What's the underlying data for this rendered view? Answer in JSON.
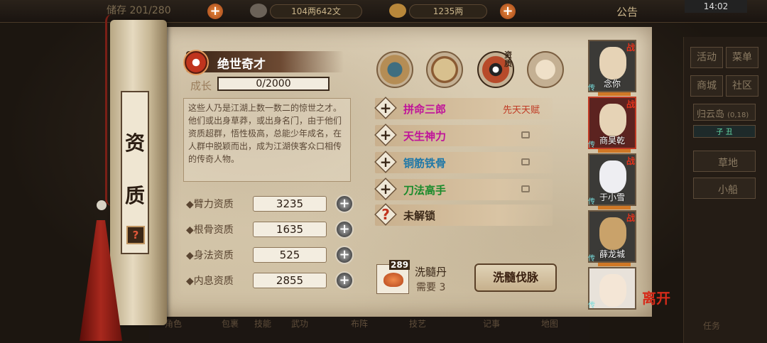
{
  "topbar": {
    "storage": "储存 201/280",
    "copper": "104两642文",
    "gold": "1235两",
    "announce": "公告",
    "time": "14:02"
  },
  "right_menu": {
    "buttons": [
      "活动",
      "菜单",
      "商城",
      "社区"
    ],
    "location": "归云岛",
    "coords": "(0,18)",
    "time_labels": [
      "子",
      "丑"
    ],
    "places": [
      "草地",
      "小船"
    ]
  },
  "dock": [
    "角色",
    "包裹",
    "技能",
    "武功",
    "布阵",
    "技艺",
    "记事",
    "地图",
    "任务"
  ],
  "scroll_tab": {
    "chars": [
      "资",
      "质"
    ],
    "help": "?"
  },
  "talent": {
    "title": "绝世奇才",
    "growth_label": "成长",
    "growth_value": "0/2000",
    "description": "这些人乃是江湖上数一数二的惊世之才。他们或出身草莽，或出身名门，由于他们资质超群，悟性极高，总能少年成名，在人群中脱颖而出，成为江湖侠客众口相传的传奇人物。"
  },
  "stats": [
    {
      "label": "◆臂力资质",
      "value": "3235"
    },
    {
      "label": "◆根骨资质",
      "value": "1635"
    },
    {
      "label": "◆身法资质",
      "value": "525"
    },
    {
      "label": "◆内息资质",
      "value": "2855"
    }
  ],
  "plus_symbol": "+",
  "icon_tag": "资质",
  "icons": [
    "hat-icon",
    "scroll-map-icon",
    "bagua-icon",
    "figure-icon"
  ],
  "skills": [
    {
      "badge": "+",
      "name": "拼命三郎",
      "color": "#c0139a",
      "tag": "先天天赋",
      "locked": false
    },
    {
      "badge": "+",
      "name": "天生神力",
      "color": "#c0139a",
      "tag": "",
      "locked": true
    },
    {
      "badge": "+",
      "name": "铜筋铁骨",
      "color": "#1f78a8",
      "tag": "",
      "locked": true
    },
    {
      "badge": "+",
      "name": "刀法高手",
      "color": "#188a2a",
      "tag": "",
      "locked": true
    },
    {
      "badge": "?",
      "name": "未解锁",
      "color": "#3a2818",
      "tag": "",
      "locked": false
    }
  ],
  "item": {
    "count": "289",
    "name": "洗髓丹",
    "need": "需要 3"
  },
  "wash_button": "洗髓伐脉",
  "characters": [
    {
      "name": "念你",
      "tag": "战",
      "pass": "传",
      "selected": false
    },
    {
      "name": "商昊乾",
      "tag": "战",
      "pass": "传",
      "selected": true
    },
    {
      "name": "于小雪",
      "tag": "战",
      "pass": "传",
      "selected": false
    },
    {
      "name": "薛龙城",
      "tag": "战",
      "pass": "传",
      "selected": false
    },
    {
      "name": "",
      "tag": "",
      "pass": "传",
      "selected": false
    }
  ],
  "leave_label": "离开"
}
